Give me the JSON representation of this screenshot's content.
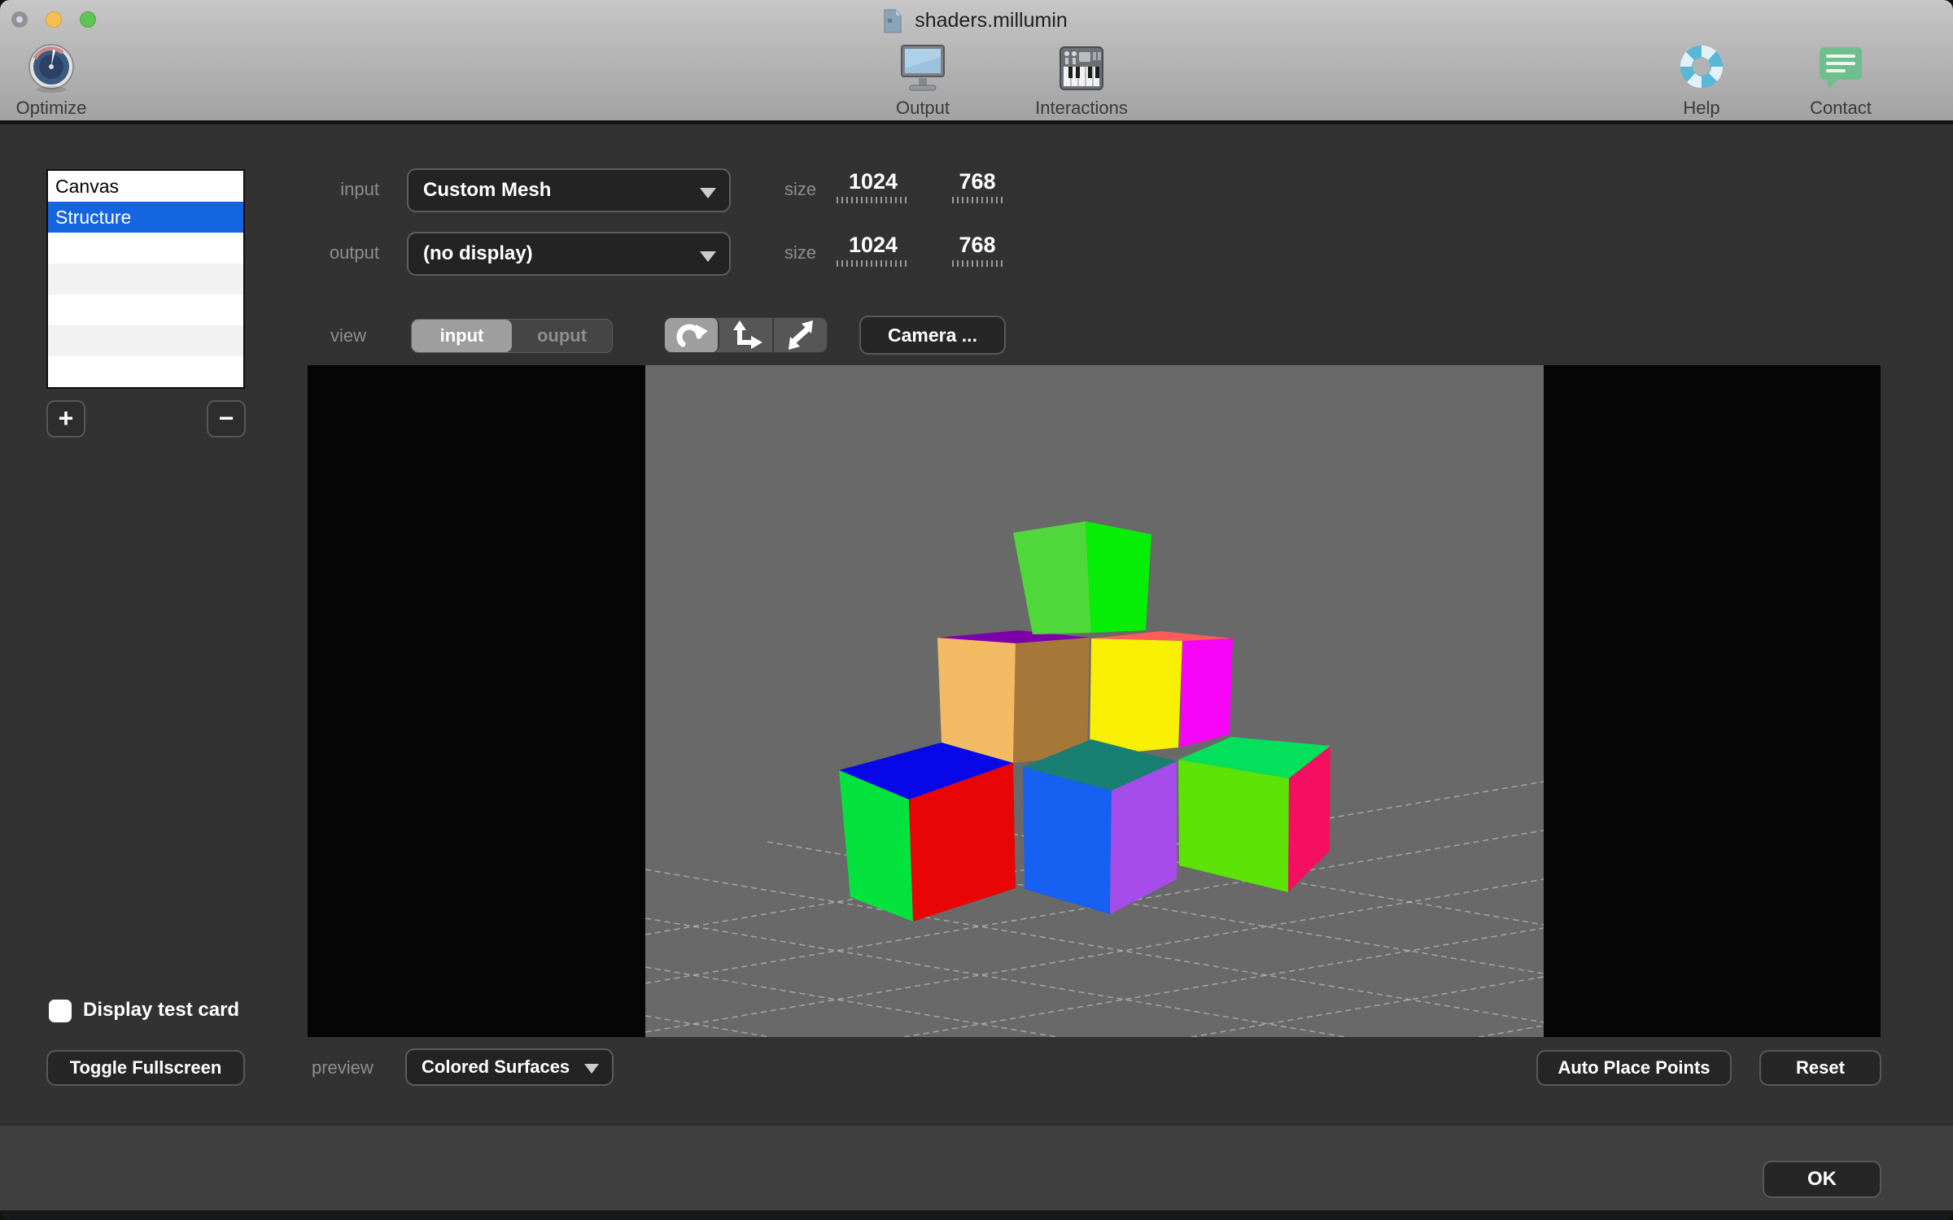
{
  "window": {
    "title": "shaders.millumin"
  },
  "toolbar": {
    "optimize_label": "Optimize",
    "output_label": "Output",
    "interactions_label": "Interactions",
    "help_label": "Help",
    "contact_label": "Contact"
  },
  "layers_list": {
    "items": [
      {
        "label": "Canvas",
        "selected": false
      },
      {
        "label": "Structure",
        "selected": true
      }
    ],
    "add_label": "+",
    "remove_label": "−"
  },
  "io": {
    "input_label": "input",
    "input_value": "Custom Mesh",
    "output_label": "output",
    "output_value": "(no display)",
    "size_label_input": "size",
    "size_label_output": "size",
    "input_width": "1024",
    "input_height": "768",
    "output_width": "1024",
    "output_height": "768"
  },
  "view_controls": {
    "view_label": "view",
    "input_tab": "input",
    "output_tab": "ouput",
    "camera_button": "Camera ..."
  },
  "preview": {
    "test_card_label": "Display test card",
    "toggle_fullscreen_button": "Toggle Fullscreen",
    "preview_label": "preview",
    "preview_mode_value": "Colored Surfaces",
    "auto_place_button": "Auto Place Points",
    "reset_button": "Reset",
    "background_color": "#696969",
    "letterbox_color": "#050505"
  },
  "scene": {
    "grid_color": "rgba(255,255,255,0.38)",
    "faces": {
      "top_cube_left": "#4fd83a",
      "top_cube_right": "#06ee06",
      "mid_left_top": "#7d00a8",
      "mid_left_left": "#f2bb63",
      "mid_left_right": "#a5783a",
      "mid_right_top": "#ff5c5c",
      "mid_right_left": "#f8ef02",
      "mid_right_right": "#f705f7",
      "bottom_left_top": "#0707e8",
      "bottom_left_left": "#04e23e",
      "bottom_left_right": "#e80505",
      "bottom_middle_top": "#187f72",
      "bottom_middle_left": "#1660f2",
      "bottom_middle_right": "#a64ceb",
      "bottom_right_top": "#05e05c",
      "bottom_right_left": "#5ce205",
      "bottom_right_right": "#f50f60"
    }
  },
  "footer": {
    "ok_button": "OK"
  },
  "colors": {
    "selection_blue": "#1565e0",
    "panel_background": "#323232",
    "footer_background": "#3f3f3f",
    "toolbar_gradient_top": "#c6c6c6",
    "toolbar_gradient_bottom": "#a2a2a2"
  }
}
